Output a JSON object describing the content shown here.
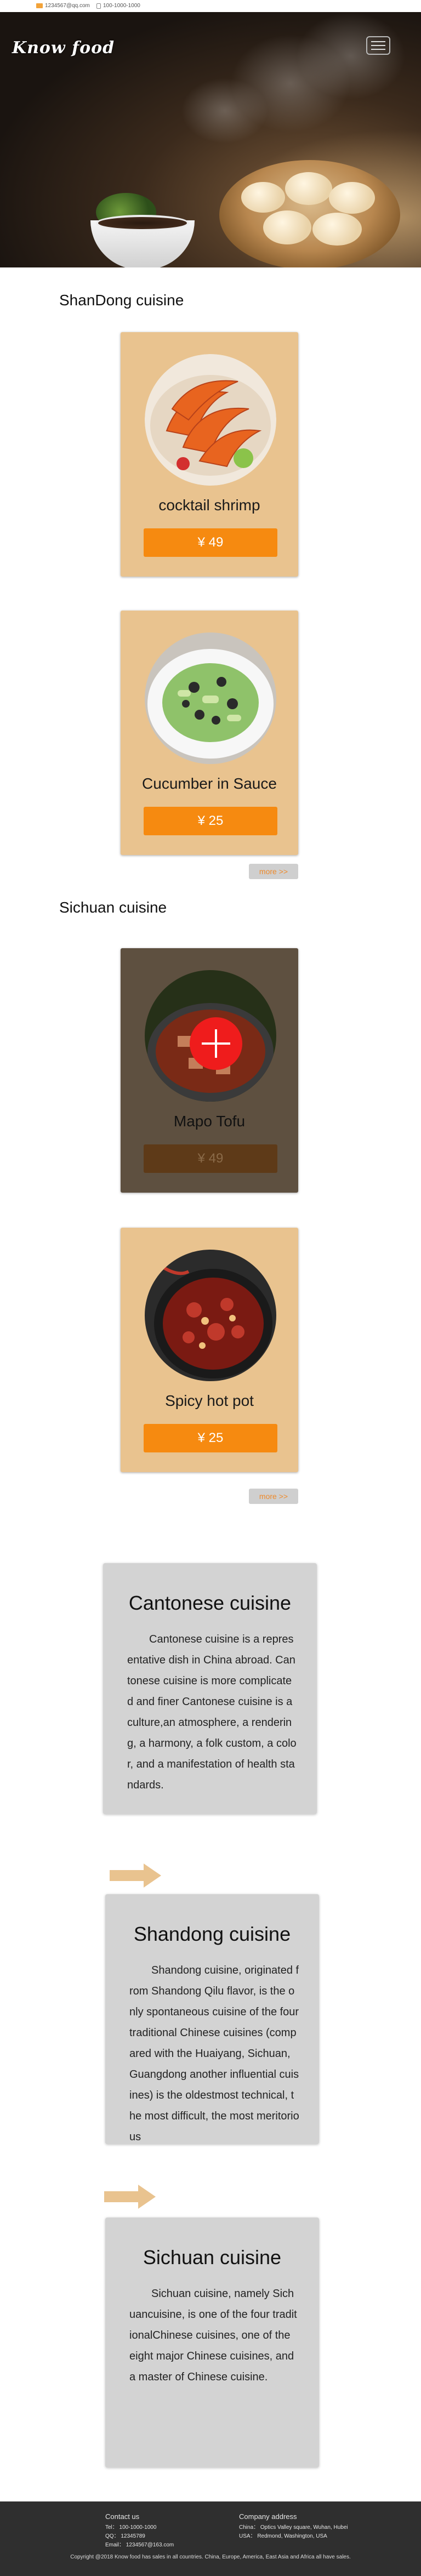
{
  "topbar": {
    "email": "1234567@qq.com",
    "phone": "100-1000-1000"
  },
  "header": {
    "logo": "Know food",
    "menu_icon": "hamburger-icon"
  },
  "sections": {
    "shandong": {
      "title": "ShanDong cuisine",
      "more": "more >>",
      "items": [
        {
          "name": "cocktail shrimp",
          "price": "¥ 49"
        },
        {
          "name": "Cucumber in Sauce",
          "price": "¥ 25"
        }
      ]
    },
    "sichuan": {
      "title": "Sichuan cuisine",
      "more": "more >>",
      "items": [
        {
          "name": "Mapo Tofu",
          "price": "¥ 49"
        },
        {
          "name": "Spicy hot pot",
          "price": "¥ 25"
        }
      ]
    }
  },
  "intros": [
    {
      "title": "Cantonese cuisine",
      "text": "Cantonese cuisine is a representative dish in China abroad. Cantonese cuisine is more complicated and finer Cantonese cuisine is a culture,an atmosphere, a rendering, a harmony, a folk custom, a color, and a manifestation of health standards."
    },
    {
      "title": "Shandong cuisine",
      "text": "Shandong cuisine, originated from Shandong Qilu flavor, is the only spontaneous cuisine of the four traditional Chinese cuisines (compared with the Huaiyang, Sichuan, Guangdong another influential cuisines) is the oldestmost technical, the most difficult, the most meritorious"
    },
    {
      "title": "Sichuan cuisine",
      "text": "Sichuan cuisine, namely Sichuancuisine, is one of the four traditionalChinese cuisines, one of the eight major Chinese cuisines, and a master of Chinese cuisine."
    }
  ],
  "footer": {
    "contact_title": "Contact us",
    "tel": "Tel： 100-1000-1000",
    "qq": "QQ： 12345789",
    "email": "Email： 1234567@163.com",
    "company_title": "Company address",
    "addr1": "China： Optics Valley square, Wuhan, Hubei",
    "addr2": "USA： Redmond, Washington, USA",
    "copyright": "Copyright @2018 Know food has sales in all countries. China, Europe, America, East Asia and Africa all have sales."
  },
  "colors": {
    "card_bg": "#e9c38f",
    "price_button": "#f68a10",
    "more_button_text": "#ee8a2b",
    "footer_bg": "#2f2f2f"
  }
}
